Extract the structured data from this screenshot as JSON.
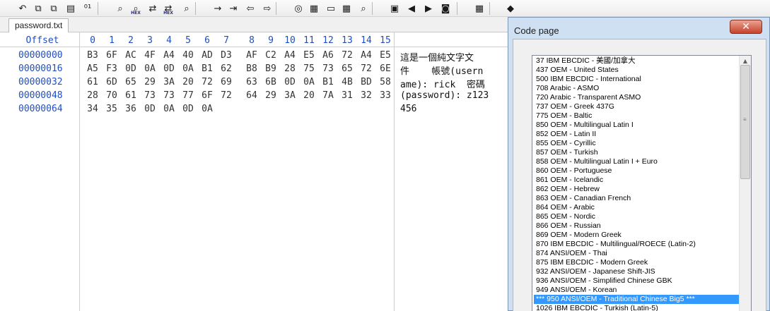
{
  "toolbar": {
    "icons": [
      {
        "name": "undo-icon",
        "glyph": "↶",
        "sub": ""
      },
      {
        "name": "copy-icon",
        "glyph": "⧉",
        "sub": ""
      },
      {
        "name": "cut-icon",
        "glyph": "⧉",
        "sub": ""
      },
      {
        "name": "paste-icon",
        "glyph": "▤",
        "sub": ""
      },
      {
        "name": "binary-icon",
        "glyph": "⁰¹",
        "sub": ""
      },
      {
        "name": "find-icon",
        "glyph": "⌕",
        "sub": ""
      },
      {
        "name": "find-hex-icon",
        "glyph": "⌕",
        "sub": "HEX"
      },
      {
        "name": "replace-icon",
        "glyph": "⇄",
        "sub": ""
      },
      {
        "name": "replace-hex-icon",
        "glyph": "⇄",
        "sub": "HEX"
      },
      {
        "name": "find-next-icon",
        "glyph": "⌕",
        "sub": ""
      },
      {
        "name": "goto-offset-icon",
        "glyph": "→",
        "sub": ""
      },
      {
        "name": "goto-block-icon",
        "glyph": "⇥",
        "sub": ""
      },
      {
        "name": "back-icon",
        "glyph": "⇦",
        "sub": ""
      },
      {
        "name": "forward-icon",
        "glyph": "⇨",
        "sub": ""
      },
      {
        "name": "disk-icon",
        "glyph": "◎",
        "sub": ""
      },
      {
        "name": "open-disk-icon",
        "glyph": "▦",
        "sub": ""
      },
      {
        "name": "ram-icon",
        "glyph": "▭",
        "sub": ""
      },
      {
        "name": "calculator-icon",
        "glyph": "▦",
        "sub": ""
      },
      {
        "name": "zoom-icon",
        "glyph": "⌕",
        "sub": ""
      },
      {
        "name": "media-icon",
        "glyph": "▣",
        "sub": ""
      },
      {
        "name": "prev-icon",
        "glyph": "◀",
        "sub": ""
      },
      {
        "name": "next-icon",
        "glyph": "▶",
        "sub": ""
      },
      {
        "name": "camera-icon",
        "glyph": "◙",
        "sub": ""
      },
      {
        "name": "table-icon",
        "glyph": "▦",
        "sub": ""
      },
      {
        "name": "help-book-icon",
        "glyph": "◆",
        "sub": ""
      }
    ]
  },
  "tab": {
    "label": "password.txt"
  },
  "editor": {
    "offset_header": "Offset",
    "columns": [
      "0",
      "1",
      "2",
      "3",
      "4",
      "5",
      "6",
      "7",
      "8",
      "9",
      "10",
      "11",
      "12",
      "13",
      "14",
      "15"
    ],
    "rows": [
      {
        "offset": "00000000",
        "hex": [
          "B3",
          "6F",
          "AC",
          "4F",
          "A4",
          "40",
          "AD",
          "D3",
          "AF",
          "C2",
          "A4",
          "E5",
          "A6",
          "72",
          "A4",
          "E5"
        ],
        "text": "這是一個純文字文"
      },
      {
        "offset": "00000016",
        "hex": [
          "A5",
          "F3",
          "0D",
          "0A",
          "0D",
          "0A",
          "B1",
          "62",
          "B8",
          "B9",
          "28",
          "75",
          "73",
          "65",
          "72",
          "6E"
        ],
        "text": "件    帳號(usern"
      },
      {
        "offset": "00000032",
        "hex": [
          "61",
          "6D",
          "65",
          "29",
          "3A",
          "20",
          "72",
          "69",
          "63",
          "6B",
          "0D",
          "0A",
          "B1",
          "4B",
          "BD",
          "58"
        ],
        "text": "ame): rick  密碼"
      },
      {
        "offset": "00000048",
        "hex": [
          "28",
          "70",
          "61",
          "73",
          "73",
          "77",
          "6F",
          "72",
          "64",
          "29",
          "3A",
          "20",
          "7A",
          "31",
          "32",
          "33"
        ],
        "text": "(password): z123"
      },
      {
        "offset": "00000064",
        "hex": [
          "34",
          "35",
          "36",
          "0D",
          "0A",
          "0D",
          "0A"
        ],
        "text": "456"
      }
    ]
  },
  "dialog": {
    "title": "Code page",
    "close_glyph": "✕",
    "codepages": [
      "37  IBM EBCDIC - 美國/加拿大",
      "437  OEM - United States",
      "500  IBM EBCDIC - International",
      "708  Arabic - ASMO",
      "720  Arabic - Transparent ASMO",
      "737  OEM - Greek 437G",
      "775  OEM - Baltic",
      "850  OEM - Multilingual Latin I",
      "852  OEM - Latin II",
      "855  OEM - Cyrillic",
      "857  OEM - Turkish",
      "858  OEM - Multilingual Latin I + Euro",
      "860  OEM - Portuguese",
      "861  OEM - Icelandic",
      "862  OEM - Hebrew",
      "863  OEM - Canadian French",
      "864  OEM - Arabic",
      "865  OEM - Nordic",
      "866  OEM - Russian",
      "869  OEM - Modern Greek",
      "870  IBM EBCDIC - Multilingual/ROECE (Latin-2)",
      "874  ANSI/OEM - Thai",
      "875  IBM EBCDIC - Modern Greek",
      "932  ANSI/OEM - Japanese Shift-JIS",
      "936  ANSI/OEM - Simplified Chinese GBK",
      "949  ANSI/OEM - Korean",
      "*** 950  ANSI/OEM - Traditional Chinese Big5 ***",
      "1026  IBM EBCDIC - Turkish (Latin-5)"
    ],
    "selected_index": 26
  }
}
